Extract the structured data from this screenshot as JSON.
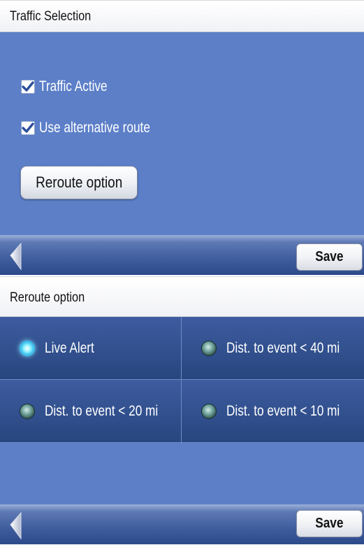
{
  "traffic_panel": {
    "title": "Traffic Selection",
    "checkboxes": [
      {
        "label": "Traffic Active",
        "checked": true
      },
      {
        "label": "Use alternative route",
        "checked": true
      }
    ],
    "reroute_button_label": "Reroute option",
    "toolbar": {
      "back_icon": "back-arrow-icon",
      "save_label": "Save"
    }
  },
  "reroute_panel": {
    "title": "Reroute option",
    "options": [
      {
        "label": "Live Alert",
        "selected": true
      },
      {
        "label": "Dist. to event < 40 mi",
        "selected": false
      },
      {
        "label": "Dist. to event < 20 mi",
        "selected": false
      },
      {
        "label": "Dist. to event < 10 mi",
        "selected": false
      }
    ],
    "toolbar": {
      "back_icon": "back-arrow-icon",
      "save_label": "Save"
    }
  },
  "colors": {
    "content_blue": "#5c7fc8",
    "option_blue": "#2f4e8c",
    "selected_radio": "#2fb6ea"
  }
}
